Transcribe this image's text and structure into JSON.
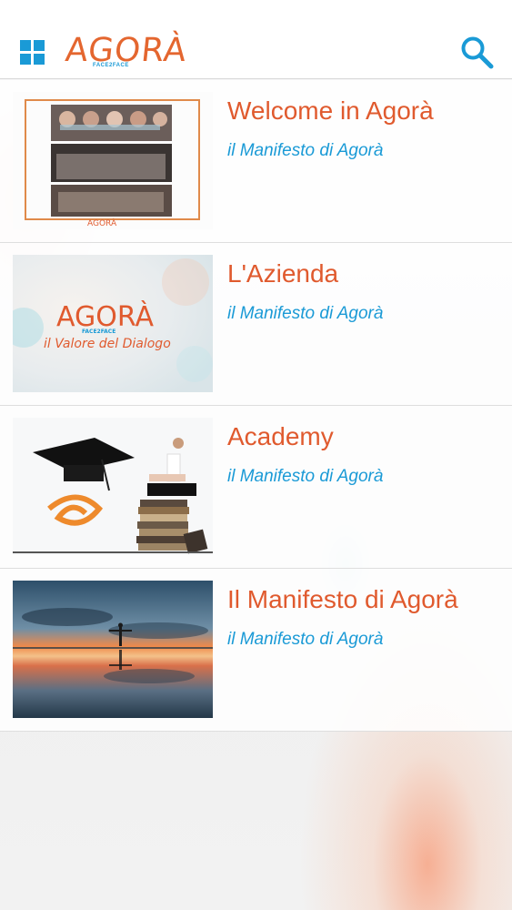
{
  "app": {
    "logo_text": "AGORÀ",
    "logo_subtext": "FACE2FACE"
  },
  "header": {
    "menu_icon": "grid-icon",
    "search_icon": "search-icon"
  },
  "colors": {
    "accent_blue": "#1a9ad6",
    "accent_orange": "#e05a2e"
  },
  "items": [
    {
      "title": "Welcome in Agorà",
      "subtitle": "il Manifesto di Agorà",
      "thumb_caption": "AGORÀ"
    },
    {
      "title": "L'Azienda",
      "subtitle": "il Manifesto di Agorà",
      "thumb_logo": "AGORÀ",
      "thumb_logo_sub": "FACE2FACE",
      "thumb_tagline": "il Valore del Dialogo"
    },
    {
      "title": "Academy",
      "subtitle": "il Manifesto di Agorà"
    },
    {
      "title": "Il Manifesto di Agorà",
      "subtitle": "il Manifesto di Agorà"
    }
  ]
}
